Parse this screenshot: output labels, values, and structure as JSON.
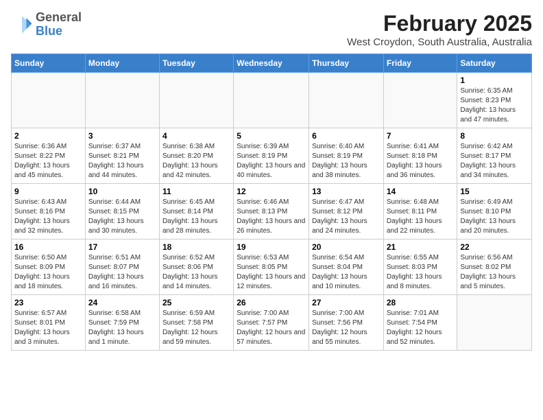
{
  "header": {
    "logo_general": "General",
    "logo_blue": "Blue",
    "month_title": "February 2025",
    "subtitle": "West Croydon, South Australia, Australia"
  },
  "days_of_week": [
    "Sunday",
    "Monday",
    "Tuesday",
    "Wednesday",
    "Thursday",
    "Friday",
    "Saturday"
  ],
  "weeks": [
    [
      {
        "day": "",
        "info": ""
      },
      {
        "day": "",
        "info": ""
      },
      {
        "day": "",
        "info": ""
      },
      {
        "day": "",
        "info": ""
      },
      {
        "day": "",
        "info": ""
      },
      {
        "day": "",
        "info": ""
      },
      {
        "day": "1",
        "info": "Sunrise: 6:35 AM\nSunset: 8:23 PM\nDaylight: 13 hours and 47 minutes."
      }
    ],
    [
      {
        "day": "2",
        "info": "Sunrise: 6:36 AM\nSunset: 8:22 PM\nDaylight: 13 hours and 45 minutes."
      },
      {
        "day": "3",
        "info": "Sunrise: 6:37 AM\nSunset: 8:21 PM\nDaylight: 13 hours and 44 minutes."
      },
      {
        "day": "4",
        "info": "Sunrise: 6:38 AM\nSunset: 8:20 PM\nDaylight: 13 hours and 42 minutes."
      },
      {
        "day": "5",
        "info": "Sunrise: 6:39 AM\nSunset: 8:19 PM\nDaylight: 13 hours and 40 minutes."
      },
      {
        "day": "6",
        "info": "Sunrise: 6:40 AM\nSunset: 8:19 PM\nDaylight: 13 hours and 38 minutes."
      },
      {
        "day": "7",
        "info": "Sunrise: 6:41 AM\nSunset: 8:18 PM\nDaylight: 13 hours and 36 minutes."
      },
      {
        "day": "8",
        "info": "Sunrise: 6:42 AM\nSunset: 8:17 PM\nDaylight: 13 hours and 34 minutes."
      }
    ],
    [
      {
        "day": "9",
        "info": "Sunrise: 6:43 AM\nSunset: 8:16 PM\nDaylight: 13 hours and 32 minutes."
      },
      {
        "day": "10",
        "info": "Sunrise: 6:44 AM\nSunset: 8:15 PM\nDaylight: 13 hours and 30 minutes."
      },
      {
        "day": "11",
        "info": "Sunrise: 6:45 AM\nSunset: 8:14 PM\nDaylight: 13 hours and 28 minutes."
      },
      {
        "day": "12",
        "info": "Sunrise: 6:46 AM\nSunset: 8:13 PM\nDaylight: 13 hours and 26 minutes."
      },
      {
        "day": "13",
        "info": "Sunrise: 6:47 AM\nSunset: 8:12 PM\nDaylight: 13 hours and 24 minutes."
      },
      {
        "day": "14",
        "info": "Sunrise: 6:48 AM\nSunset: 8:11 PM\nDaylight: 13 hours and 22 minutes."
      },
      {
        "day": "15",
        "info": "Sunrise: 6:49 AM\nSunset: 8:10 PM\nDaylight: 13 hours and 20 minutes."
      }
    ],
    [
      {
        "day": "16",
        "info": "Sunrise: 6:50 AM\nSunset: 8:09 PM\nDaylight: 13 hours and 18 minutes."
      },
      {
        "day": "17",
        "info": "Sunrise: 6:51 AM\nSunset: 8:07 PM\nDaylight: 13 hours and 16 minutes."
      },
      {
        "day": "18",
        "info": "Sunrise: 6:52 AM\nSunset: 8:06 PM\nDaylight: 13 hours and 14 minutes."
      },
      {
        "day": "19",
        "info": "Sunrise: 6:53 AM\nSunset: 8:05 PM\nDaylight: 13 hours and 12 minutes."
      },
      {
        "day": "20",
        "info": "Sunrise: 6:54 AM\nSunset: 8:04 PM\nDaylight: 13 hours and 10 minutes."
      },
      {
        "day": "21",
        "info": "Sunrise: 6:55 AM\nSunset: 8:03 PM\nDaylight: 13 hours and 8 minutes."
      },
      {
        "day": "22",
        "info": "Sunrise: 6:56 AM\nSunset: 8:02 PM\nDaylight: 13 hours and 5 minutes."
      }
    ],
    [
      {
        "day": "23",
        "info": "Sunrise: 6:57 AM\nSunset: 8:01 PM\nDaylight: 13 hours and 3 minutes."
      },
      {
        "day": "24",
        "info": "Sunrise: 6:58 AM\nSunset: 7:59 PM\nDaylight: 13 hours and 1 minute."
      },
      {
        "day": "25",
        "info": "Sunrise: 6:59 AM\nSunset: 7:58 PM\nDaylight: 12 hours and 59 minutes."
      },
      {
        "day": "26",
        "info": "Sunrise: 7:00 AM\nSunset: 7:57 PM\nDaylight: 12 hours and 57 minutes."
      },
      {
        "day": "27",
        "info": "Sunrise: 7:00 AM\nSunset: 7:56 PM\nDaylight: 12 hours and 55 minutes."
      },
      {
        "day": "28",
        "info": "Sunrise: 7:01 AM\nSunset: 7:54 PM\nDaylight: 12 hours and 52 minutes."
      },
      {
        "day": "",
        "info": ""
      }
    ]
  ]
}
